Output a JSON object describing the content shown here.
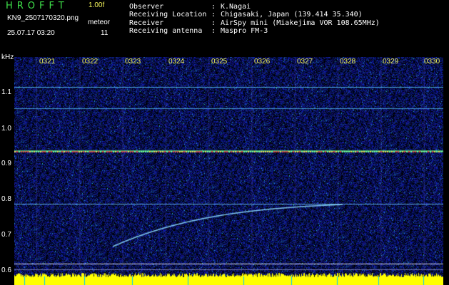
{
  "header": {
    "app_title": "HROFFT",
    "version": "1.00f",
    "filename": "KN9_2507170320.png",
    "meteor_label": "meteor",
    "datetime": "25.07.17 03:20",
    "meteor_count": "11"
  },
  "info": [
    {
      "label": "Observer",
      "value": "K.Nagai"
    },
    {
      "label": "Receiving Location",
      "value": "Chigasaki, Japan (139.414 35.340)"
    },
    {
      "label": "Receiver",
      "value": "AirSpy mini (Miakejima VOR 108.65MHz)"
    },
    {
      "label": "Receiving antenna",
      "value": "Maspro FM-3"
    }
  ],
  "axis": {
    "unit": "kHz",
    "y_ticks": [
      "1.1",
      "1.0",
      "0.9",
      "0.8",
      "0.7",
      "0.6"
    ],
    "time_ticks": [
      "0321",
      "0322",
      "0323",
      "0324",
      "0325",
      "0326",
      "0327",
      "0328",
      "0329",
      "0330"
    ]
  },
  "colors": {
    "background": "#000000",
    "noise": "#0b1a8a",
    "signal": "#7fd6ff",
    "carrier_hot": "#ff3030",
    "baseline": "#ffff00",
    "tick_text": "#ffff00"
  }
}
